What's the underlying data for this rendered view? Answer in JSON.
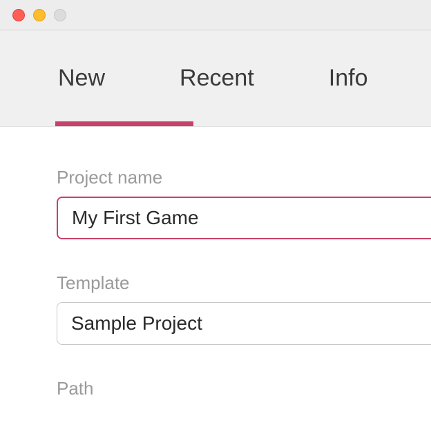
{
  "titlebar": {
    "close": "close",
    "minimize": "minimize",
    "maximize": "maximize"
  },
  "tabs": {
    "new": "New",
    "recent": "Recent",
    "info": "Info"
  },
  "form": {
    "project_name_label": "Project name",
    "project_name_value": "My First Game",
    "template_label": "Template",
    "template_value": "Sample Project",
    "path_label": "Path"
  }
}
